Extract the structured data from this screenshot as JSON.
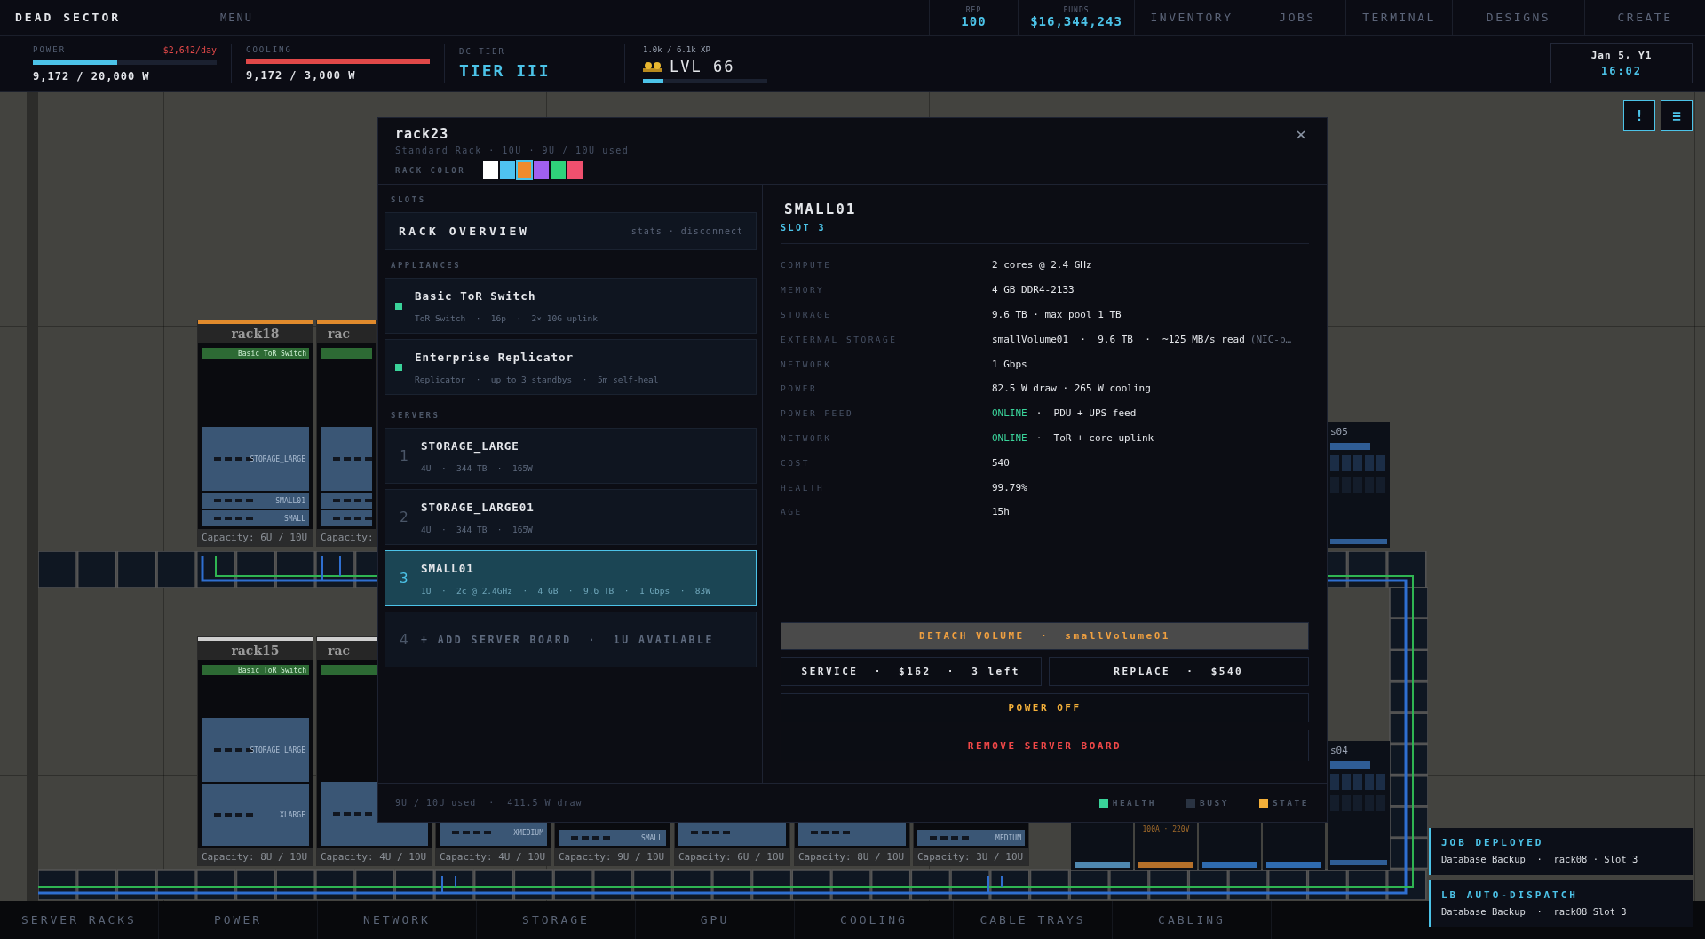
{
  "app": {
    "title": "DEAD SECTOR",
    "menu": "MENU"
  },
  "top_stats": [
    {
      "label": "REP",
      "value": "100"
    },
    {
      "label": "FUNDS",
      "value": "$16,344,243"
    }
  ],
  "nav": [
    "INVENTORY",
    "JOBS",
    "TERMINAL",
    "DESIGNS",
    "CREATE"
  ],
  "meters": [
    {
      "label": "POWER",
      "cost": "-$2,642/day",
      "level": 0.46,
      "over": false,
      "reading": "9,172 / 20,000 W"
    },
    {
      "label": "COOLING",
      "level": 1,
      "over": true,
      "reading": "9,172 / 3,000 W"
    }
  ],
  "tier": {
    "label": "DC TIER",
    "value": "TIER III"
  },
  "xp": {
    "progress": "1.0k / 6.1k XP",
    "level_text": "LVL 66",
    "level": 0.164
  },
  "clock": {
    "date": "Jan 5, Y1",
    "time": "16:02"
  },
  "canvas_buttons": [
    "!",
    "≡"
  ],
  "floor": {
    "racks": [
      {
        "name": "rack18",
        "color": "#e08a2c",
        "switch": true,
        "switch_label": "Basic ToR Switch",
        "servers": [
          {
            "kind": "storage",
            "label": "STORAGE_LARGE"
          },
          {
            "kind": "small",
            "label": "SMALL01"
          },
          {
            "kind": "small",
            "label": "SMALL"
          }
        ],
        "capacity": "Capacity: 6U / 10U"
      },
      {
        "name": "rac",
        "color": "#e08a2c",
        "switch": true,
        "servers": [
          {
            "kind": "storage"
          },
          {
            "kind": "small"
          },
          {
            "kind": "small"
          }
        ],
        "capacity": "Capacity:"
      },
      {
        "name": "rack15",
        "color": "#cfcfcf",
        "switch": true,
        "switch_label": "Basic ToR Switch",
        "servers": [
          {
            "kind": "storage",
            "label": "STORAGE_LARGE"
          },
          {
            "kind": "xlarge",
            "label": "XLARGE"
          }
        ],
        "capacity": "Capacity: 8U / 10U"
      },
      {
        "name": "rac",
        "color": "#cfcfcf",
        "switch": true,
        "servers": [
          {
            "kind": "storage"
          }
        ],
        "capacity": "Capacity: 4U / 10U"
      },
      {
        "servers": [
          {
            "kind": "medium",
            "label": "XMEDIUM"
          }
        ],
        "capacity": "Capacity: 4U / 10U"
      },
      {
        "servers": [
          {
            "kind": "small",
            "label": "SMALL"
          }
        ],
        "capacity": "Capacity: 9U / 10U"
      },
      {
        "servers": [
          {
            "kind": "medium"
          }
        ],
        "capacity": "Capacity: 6U / 10U"
      },
      {
        "servers": [
          {
            "kind": "medium"
          }
        ],
        "capacity": "Capacity: 8U / 10U"
      },
      {
        "servers": [
          {
            "kind": "small",
            "label": "MEDIUM"
          }
        ],
        "capacity": "Capacity: 3U / 10U"
      }
    ],
    "ups": [
      {
        "name": "s05"
      },
      {
        "name": "s04"
      }
    ],
    "units": [
      {
        "color": "#4f88b0"
      },
      {
        "color": "#b5702a",
        "rating": "100A · 220V"
      },
      {
        "color": "#2f6bb0"
      },
      {
        "color": "#2f6bb0"
      }
    ]
  },
  "modal": {
    "title": "rack23",
    "subtitle": "Standard Rack · 10U · 9U / 10U used",
    "close": "×",
    "color_label": "RACK COLOR",
    "colors": [
      {
        "color": "#ffffff",
        "selected": false
      },
      {
        "color": "#4fc3f0",
        "selected": false
      },
      {
        "color": "#ef8b2c",
        "selected": true
      },
      {
        "color": "#a160f0",
        "selected": false
      },
      {
        "color": "#2fd27a",
        "selected": false
      },
      {
        "color": "#f0506e",
        "selected": false
      }
    ],
    "slots_heading": "SLOTS",
    "overview": {
      "label": "RACK OVERVIEW",
      "hint": "stats · disconnect"
    },
    "appliances_heading": "APPLIANCES",
    "appliances": [
      {
        "name": "Basic ToR Switch",
        "detail": "ToR Switch  ·  16p  ·  2× 10G uplink",
        "color": "#3ad39a"
      },
      {
        "name": "Enterprise Replicator",
        "detail": "Replicator  ·  up to 3 standbys  ·  5m self-heal",
        "color": "#3ad39a"
      }
    ],
    "servers_heading": "SERVERS",
    "servers": [
      {
        "kind": "server",
        "slot": "1",
        "name": "STORAGE_LARGE",
        "detail": "4U  ·  344 TB  ·  165W",
        "selected": false
      },
      {
        "kind": "server",
        "slot": "2",
        "name": "STORAGE_LARGE01",
        "detail": "4U  ·  344 TB  ·  165W",
        "selected": false
      },
      {
        "kind": "server",
        "slot": "3",
        "name": "SMALL01",
        "detail": "1U  ·  2c @ 2.4GHz  ·  4 GB  ·  9.6 TB  ·  1 Gbps  ·  83W",
        "selected": true
      },
      {
        "kind": "add",
        "slot": "4",
        "name": "+ ADD SERVER BOARD  ·  1U AVAILABLE",
        "selected": false
      }
    ],
    "detail": {
      "title": "SMALL01",
      "slot": "SLOT 3",
      "specs": [
        {
          "label": "COMPUTE",
          "value": "2 cores @ 2.4 GHz"
        },
        {
          "label": "MEMORY",
          "value": "4 GB DDR4-2133"
        },
        {
          "label": "STORAGE",
          "value": "9.6 TB · max pool 1 TB"
        },
        {
          "label": "EXTERNAL STORAGE",
          "value": "smallVolume01  ·  9.6 TB  ·  ~125 MB/s read",
          "note": "(NIC-b…"
        },
        {
          "label": "NETWORK",
          "value": "1 Gbps"
        },
        {
          "label": "POWER",
          "value": "82.5 W draw · 265 W cooling"
        },
        {
          "label": "POWER FEED",
          "status": "ONLINE",
          "value": "·  PDU + UPS feed"
        },
        {
          "label": "NETWORK",
          "status": "ONLINE",
          "value": "·  ToR + core uplink"
        },
        {
          "label": "COST",
          "value": "540"
        },
        {
          "label": "HEALTH",
          "value": "99.79%"
        },
        {
          "label": "AGE",
          "value": "15h"
        }
      ],
      "actions": [
        [
          {
            "label": "DETACH VOLUME  ·  smallVolume01",
            "kind": "filled"
          }
        ],
        [
          {
            "label": "SERVICE  ·  $162  ·  3 left",
            "kind": "neutral"
          },
          {
            "label": "REPLACE  ·  $540",
            "kind": "neutral"
          }
        ],
        [
          {
            "label": "POWER OFF",
            "kind": "warn"
          }
        ],
        [
          {
            "label": "REMOVE SERVER BOARD",
            "kind": "danger"
          }
        ]
      ]
    },
    "footer": "9U / 10U used  ·  411.5 W draw",
    "legend": [
      {
        "label": "HEALTH",
        "color": "#3ad39a"
      },
      {
        "label": "BUSY",
        "color": "#2a3342"
      },
      {
        "label": "STATE",
        "color": "#f4b03a"
      }
    ]
  },
  "notifications": [
    {
      "title": "JOB DEPLOYED",
      "body": "Database Backup  ·  rack08 · Slot 3"
    },
    {
      "title": "LB AUTO-DISPATCH",
      "body": "Database Backup  ·  rack08 Slot 3"
    }
  ],
  "tabs": [
    "SERVER RACKS",
    "POWER",
    "NETWORK",
    "STORAGE",
    "GPU",
    "COOLING",
    "CABLE TRAYS",
    "CABLING"
  ]
}
